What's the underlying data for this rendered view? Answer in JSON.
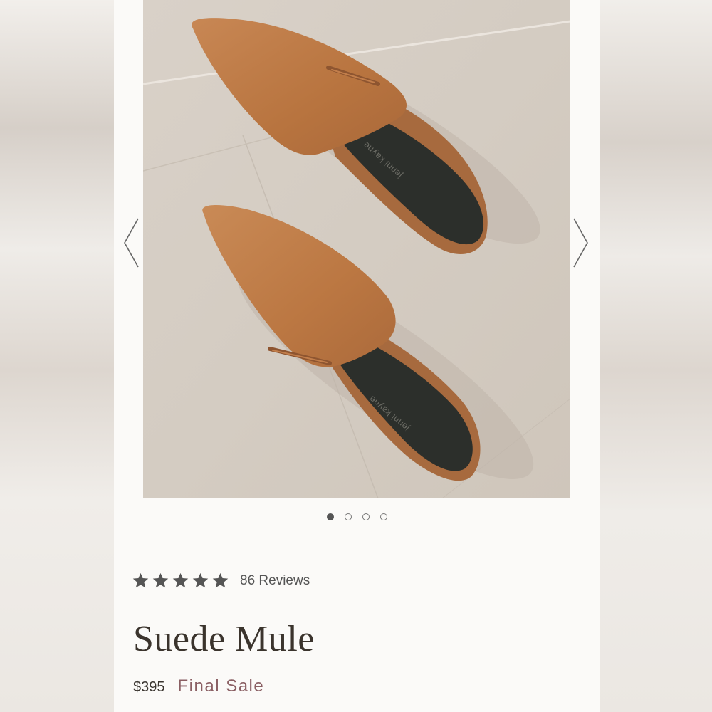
{
  "product": {
    "name": "Suede Mule",
    "price": "$395",
    "sale_label": "Final Sale",
    "image_brand_mark": "jenni kayne"
  },
  "rating": {
    "stars": 5,
    "reviews_text": "86 Reviews"
  },
  "gallery": {
    "slide_count": 4,
    "active_slide": 1
  },
  "icons": {
    "prev": "chevron-left-icon",
    "next": "chevron-right-icon",
    "star": "star-icon"
  },
  "colors": {
    "page_bg": "#fbfaf8",
    "sale_text": "#8a5f63",
    "title_text": "#3b342d",
    "star_fill": "#555555",
    "suede": "#c07a46"
  }
}
